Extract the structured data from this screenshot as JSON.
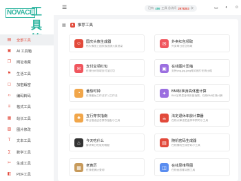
{
  "logo": {
    "en": "NOVACE",
    "cn": "工具箱"
  },
  "sidebar": {
    "items": [
      {
        "label": "全部工具",
        "icon": "grid-icon",
        "glyph": "▤"
      },
      {
        "label": "AI 工具箱",
        "icon": "ai-icon",
        "glyph": "▣"
      },
      {
        "label": "网址收藏",
        "icon": "bookmark-icon",
        "glyph": "❐"
      },
      {
        "label": "生活工具",
        "icon": "flag-icon",
        "glyph": "⚑"
      },
      {
        "label": "加密解密",
        "icon": "lock-icon",
        "glyph": "▢"
      },
      {
        "label": "编码转码",
        "icon": "code-icon",
        "glyph": "‹›"
      },
      {
        "label": "格式工具",
        "icon": "format-icon",
        "glyph": "≡"
      },
      {
        "label": "站长工具",
        "icon": "webmaster-icon",
        "glyph": "▦"
      },
      {
        "label": "图片修改",
        "icon": "image-icon",
        "glyph": "▨"
      },
      {
        "label": "文本工具",
        "icon": "text-icon",
        "glyph": "T"
      },
      {
        "label": "数学工具",
        "icon": "math-icon",
        "glyph": "∑"
      },
      {
        "label": "生成工具",
        "icon": "generate-icon",
        "glyph": "✂"
      },
      {
        "label": "PDF工具",
        "icon": "pdf-icon",
        "glyph": "◧"
      }
    ]
  },
  "header": {
    "stats_prefix": "已有",
    "stats_count": "486",
    "stats_mid": "工具 总访问",
    "stats_visits": "2978283",
    "stats_suffix": "次"
  },
  "main": {
    "section_title": "推荐工具",
    "cards": [
      {
        "title": "国庆头像生成器",
        "desc": "给头像加上国庆版国旗元素渲染",
        "color": "#e24a3b",
        "icon": "avatar-icon",
        "glyph": "☺"
      },
      {
        "title": "外卖红包领取",
        "desc": "外卖每日红包领取",
        "color": "#f0565e",
        "icon": "redpacket-icon",
        "glyph": "✉"
      },
      {
        "title": "支付宝领红包",
        "desc": "在线扫码领取支付宝红包",
        "color": "#f0565e",
        "icon": "alipay-icon",
        "glyph": "✉"
      },
      {
        "title": "在线图片压缩",
        "desc": "支持png,jpg,jpeg格式图片在线压缩",
        "color": "#9b6fe0",
        "icon": "compress-icon",
        "glyph": "▣"
      },
      {
        "title": "番茄时钟",
        "desc": "在线番茄工作法学习工作法",
        "color": "#f1a64a",
        "icon": "clock-icon",
        "glyph": "◔"
      },
      {
        "title": "BMI标准身高体重计算",
        "desc": "BMI全称是身体质量指数，在线BMI在线计算",
        "color": "#9b6fe0",
        "icon": "bmi-icon",
        "glyph": "✦"
      },
      {
        "title": "五行穿衣指南",
        "desc": "每日推送适合穿衣搭配小工具",
        "color": "#f1a64a",
        "icon": "wardrobe-icon",
        "glyph": "♣"
      },
      {
        "title": "法定退休年龄计算器",
        "desc": "在线计算法定退休年龄的小工具",
        "color": "#e24a3b",
        "icon": "retire-icon",
        "glyph": "☕"
      },
      {
        "title": "今天吃什么",
        "desc": "解决每日吃饭的难题",
        "color": "#333333",
        "icon": "food-icon",
        "glyph": "♨"
      },
      {
        "title": "随机密码生成器",
        "desc": "在线随机生成密码小工具",
        "color": "#e24a3b",
        "icon": "password-icon",
        "glyph": "▤"
      },
      {
        "title": "老黄历",
        "desc": "在线老黄历查询",
        "color": "#c79a5b",
        "icon": "almanac-icon",
        "glyph": "▦"
      },
      {
        "title": "在线思维导图",
        "desc": "在线画思维导图工具",
        "color": "#5a8df0",
        "icon": "mindmap-icon",
        "glyph": "◫"
      }
    ]
  }
}
